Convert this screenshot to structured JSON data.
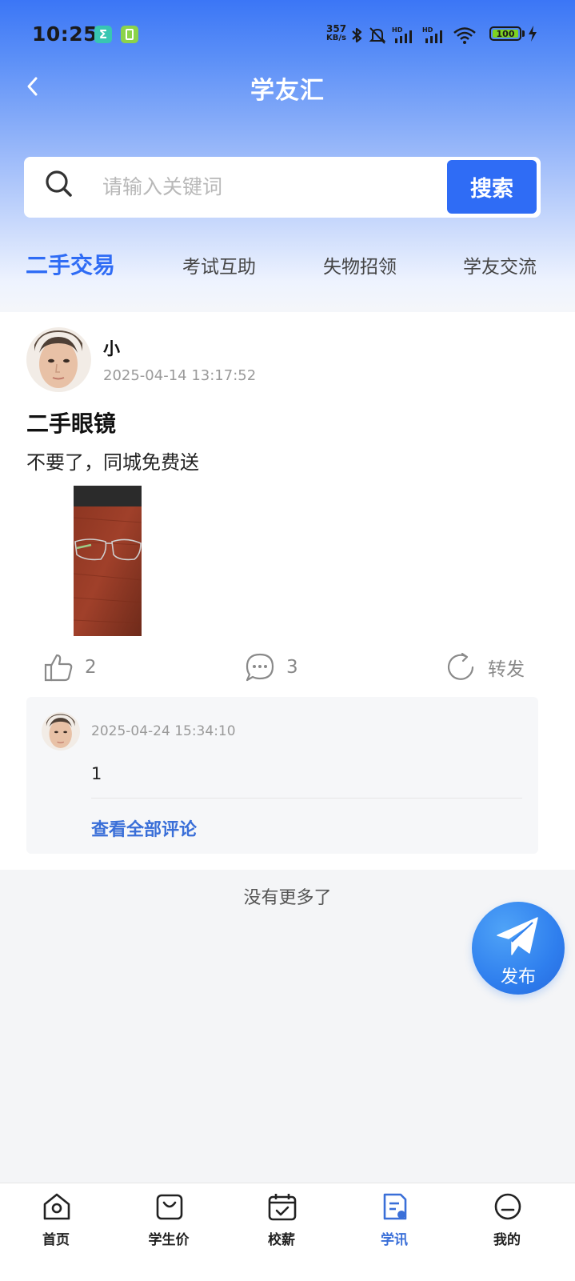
{
  "status_bar": {
    "time": "10:25",
    "app_icon_1": "Σ",
    "network_speed_value": "357",
    "network_speed_unit": "KB/s",
    "battery": "100",
    "icons": [
      "bluetooth-icon",
      "mute-icon",
      "signal-hd-icon",
      "signal-hd-icon",
      "wifi-icon",
      "charging-icon"
    ]
  },
  "nav": {
    "title": "学友汇"
  },
  "search": {
    "placeholder": "请输入关键词",
    "value": "",
    "button_label": "搜索"
  },
  "tabs": [
    {
      "label": "二手交易",
      "active": true
    },
    {
      "label": "考试互助",
      "active": false
    },
    {
      "label": "失物招领",
      "active": false
    },
    {
      "label": "学友交流",
      "active": false
    }
  ],
  "post": {
    "author": "小",
    "time": "2025-04-14 13:17:52",
    "title": "二手眼镜",
    "content": "不要了，同城免费送",
    "likes": "2",
    "comments": "3",
    "share_label": "转发",
    "comment_preview": {
      "time": "2025-04-24 15:34:10",
      "text": "1",
      "view_all_label": "查看全部评论"
    }
  },
  "footer_text": "没有更多了",
  "fab": {
    "label": "发布"
  },
  "bottom_nav": [
    {
      "label": "首页",
      "icon": "home-icon",
      "active": false
    },
    {
      "label": "学生价",
      "icon": "shopping-bag-icon",
      "active": false
    },
    {
      "label": "校薪",
      "icon": "calendar-check-icon",
      "active": false
    },
    {
      "label": "学讯",
      "icon": "document-icon",
      "active": true
    },
    {
      "label": "我的",
      "icon": "profile-icon",
      "active": false
    }
  ],
  "colors": {
    "accent": "#2f6cf5",
    "link": "#3a6fd8",
    "header_top": "#3b76f6",
    "muted": "#9a9a9a"
  }
}
